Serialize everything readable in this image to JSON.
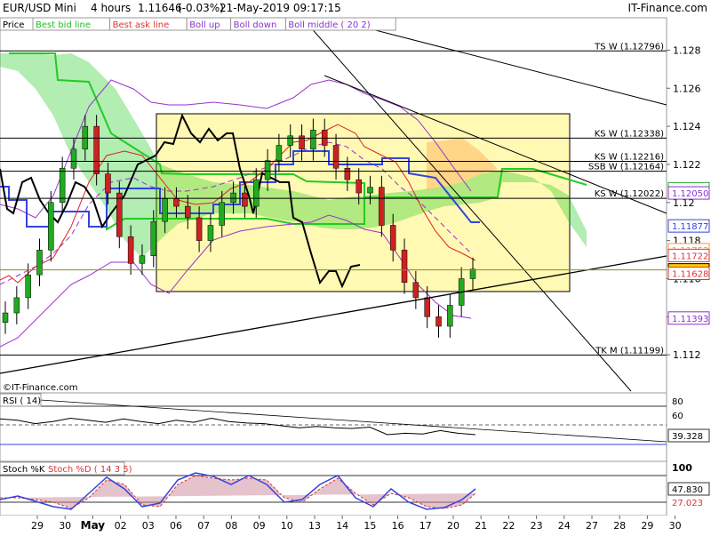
{
  "header": {
    "symbol": "EUR/USD Mini",
    "timeframe": "4 hours",
    "price": "1.11646",
    "change": "(-0.03%)",
    "datetime": "21-May-2019 09:17:15",
    "brand": "IT-Finance.com"
  },
  "legend": {
    "items": [
      {
        "label": "Price",
        "color": "#000000"
      },
      {
        "label": "Best bid line",
        "color": "#22bb22"
      },
      {
        "label": "Best ask line",
        "color": "#dd3333"
      },
      {
        "label": "Boll up",
        "color": "#8833cc"
      },
      {
        "label": "Boll down",
        "color": "#8833cc"
      },
      {
        "label": "Boll middle ( 20 2)",
        "color": "#8833cc"
      }
    ]
  },
  "watermark": "©IT-Finance.com",
  "colors": {
    "up_candle": "#22aa22",
    "down_candle": "#cc2222",
    "kijun": "#3344dd",
    "cloud_green": "#22cc22",
    "cloud_orange": "#ffaa55",
    "boll": "#9933cc",
    "highlight_box": "#fff79a",
    "lagging": "#000000"
  },
  "chart_data": [
    {
      "type": "line",
      "title": "EUR/USD Mini 4 hours",
      "ylim": [
        1.11,
        1.1297
      ],
      "yticks": [
        "1.112",
        "1.114",
        "1.116",
        "1.118",
        "1.12",
        "1.122",
        "1.124",
        "1.126",
        "1.128"
      ],
      "x_ticks": [
        "29",
        "30",
        "May",
        "02",
        "03",
        "06",
        "07",
        "08",
        "09",
        "10",
        "13",
        "14",
        "15",
        "16",
        "17",
        "20",
        "21",
        "22",
        "23",
        "24",
        "27",
        "28",
        "29",
        "30"
      ],
      "close_series": [
        1.1142,
        1.115,
        1.1162,
        1.1175,
        1.12,
        1.1218,
        1.1228,
        1.124,
        1.1215,
        1.1205,
        1.1182,
        1.1168,
        1.1172,
        1.119,
        1.1202,
        1.1198,
        1.1192,
        1.118,
        1.1188,
        1.12,
        1.1205,
        1.1198,
        1.1212,
        1.1222,
        1.123,
        1.1235,
        1.1228,
        1.1238,
        1.123,
        1.1218,
        1.1212,
        1.1205,
        1.1208,
        1.1188,
        1.1175,
        1.1158,
        1.115,
        1.114,
        1.1135,
        1.1146,
        1.116,
        1.1165
      ],
      "price_levels": [
        {
          "label": "TS W (1.12796)",
          "value": 1.12796
        },
        {
          "label": "KS W (1.12338)",
          "value": 1.12338
        },
        {
          "label": "KS W (1.12216)",
          "value": 1.12216
        },
        {
          "label": "SSB W (1.12164)",
          "value": 1.12164
        },
        {
          "label": "KS W (1.12022)",
          "value": 1.12022
        },
        {
          "label": "TK M (1.11199)",
          "value": 1.11199
        }
      ],
      "price_tags": [
        {
          "text": "1.12072",
          "value": 1.12072,
          "color": "#22aa22"
        },
        {
          "text": "1.12050",
          "value": 1.1205,
          "color": "#8833cc"
        },
        {
          "text": "1.11877",
          "value": 1.11877,
          "color": "#3344dd"
        },
        {
          "text": "1.11752",
          "value": 1.11752,
          "color": "#ff9933"
        },
        {
          "text": "1.11722",
          "value": 1.11722,
          "color": "#dd3333"
        },
        {
          "text": "1.11646",
          "value": 1.11646,
          "color": "#000000",
          "bg": "#ffcc00"
        },
        {
          "text": "1.11628",
          "value": 1.11628,
          "color": "#dd3333"
        },
        {
          "text": "1.11393",
          "value": 1.11393,
          "color": "#8833cc"
        }
      ]
    },
    {
      "type": "line",
      "title": "RSI ( 14)",
      "ylim": [
        0,
        100
      ],
      "yticks": [
        "80",
        "60"
      ],
      "current": "39.328",
      "values": [
        62,
        60,
        55,
        58,
        63,
        60,
        57,
        62,
        58,
        55,
        60,
        57,
        63,
        58,
        56,
        55,
        52,
        49,
        51,
        49,
        48,
        50,
        39,
        41,
        40,
        45,
        41,
        39
      ]
    },
    {
      "type": "line",
      "title": "Stoch %K",
      "series_names": [
        "Stoch %K",
        "Stoch %D ( 14 3 5)"
      ],
      "ylim": [
        0,
        100
      ],
      "yticks": [
        "100"
      ],
      "k_current": "47.830",
      "d_current": "27.023"
    }
  ]
}
